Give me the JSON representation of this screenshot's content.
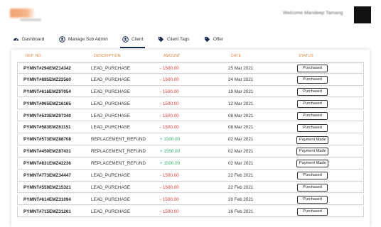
{
  "header": {
    "welcome_text": "Welcome Mandeep Tamang"
  },
  "nav": {
    "items": [
      {
        "label": "Dashboard",
        "icon": "dashboard-icon"
      },
      {
        "label": "Manage Sub Admin",
        "icon": "user-circle-icon"
      },
      {
        "label": "Client",
        "icon": "user-circle-icon",
        "active": true
      },
      {
        "label": "Client Tags",
        "icon": "tag-icon"
      },
      {
        "label": "Offer",
        "icon": "tag-icon"
      }
    ]
  },
  "table": {
    "columns": {
      "ref": "REF. NO",
      "description": "DESCRIPTION",
      "amount": "AMOUNT",
      "date": "DATE",
      "status": "STATUS"
    },
    "rows": [
      {
        "ref": "PYMNT#294EMZ14342",
        "description": "LEAD_PURCHASE",
        "amount": "- 1500.00",
        "date": "25 Mar 2021",
        "status": "Purchased"
      },
      {
        "ref": "PYMNT#895EMZ22560",
        "description": "LEAD_PURCHASE",
        "amount": "- 1500.00",
        "date": "24 Mar 2021",
        "status": "Purchased"
      },
      {
        "ref": "PYMNT#616EMZ97054",
        "description": "LEAD_PURCHASE",
        "amount": "- 1500.00",
        "date": "19 Mar 2021",
        "status": "Purchased"
      },
      {
        "ref": "PYMNT#965EMZ16165",
        "description": "LEAD_PURCHASE",
        "amount": "- 1500.00",
        "date": "12 Mar 2021",
        "status": "Purchased"
      },
      {
        "ref": "PYMNT#533EMZ97340",
        "description": "LEAD_PURCHASE",
        "amount": "- 1500.00",
        "date": "08 Mar 2021",
        "status": "Purchased"
      },
      {
        "ref": "PYMNT#583EMZ61151",
        "description": "LEAD_PURCHASE",
        "amount": "- 1500.00",
        "date": "08 Mar 2021",
        "status": "Purchased"
      },
      {
        "ref": "PYMNT#573EMZ88708",
        "description": "REPLACEMENT_REFUND",
        "amount": "+ 1500.00",
        "date": "02 Mar 2021",
        "status": "Payment Made"
      },
      {
        "ref": "PYMNT#450EMZ87431",
        "description": "REPLACEMENT_REFUND",
        "amount": "+ 1500.00",
        "date": "02 Mar 2021",
        "status": "Payment Made"
      },
      {
        "ref": "PYMNT#831EMZ42236",
        "description": "REPLACEMENT_REFUND",
        "amount": "+ 1500.00",
        "date": "02 Mar 2021",
        "status": "Payment Made"
      },
      {
        "ref": "PYMNT#773EMZ34447",
        "description": "LEAD_PURCHASE",
        "amount": "- 1500.00",
        "date": "22 Feb 2021",
        "status": "Purchased"
      },
      {
        "ref": "PYMNT#559EMZ15321",
        "description": "LEAD_PURCHASE",
        "amount": "- 1500.00",
        "date": "22 Feb 2021",
        "status": "Purchased"
      },
      {
        "ref": "PYMNT#614EMZ31094",
        "description": "LEAD_PURCHASE",
        "amount": "- 1500.00",
        "date": "20 Feb 2021",
        "status": "Purchased"
      },
      {
        "ref": "PYMNT#715EMZ31261",
        "description": "LEAD_PURCHASE",
        "amount": "- 1500.00",
        "date": "16 Feb 2021",
        "status": "Purchased"
      }
    ]
  },
  "colors": {
    "accent_header": "#e0803d",
    "negative_amount": "#e23838",
    "positive_amount": "#2fb36c",
    "nav_active": "#17294d",
    "avatar": "#111111"
  }
}
